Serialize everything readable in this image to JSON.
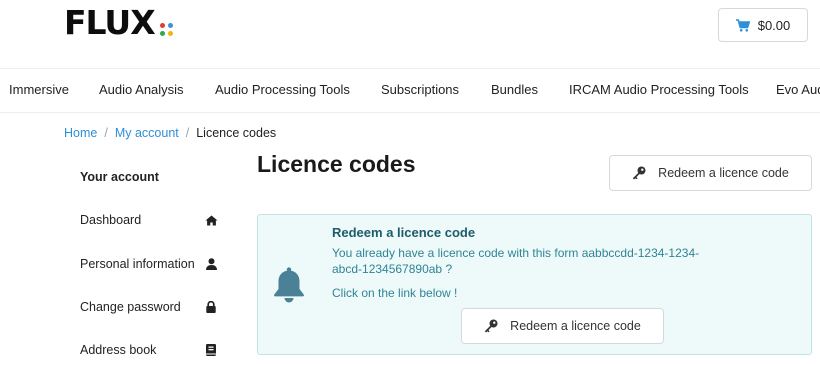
{
  "brand": {
    "name": "FLUX",
    "dot_colors": [
      "#e53935",
      "#3d8fd6",
      "#2ea84a",
      "#f2b705"
    ]
  },
  "cart": {
    "icon": "shopping-cart-icon",
    "total": "$0.00"
  },
  "nav": {
    "items": [
      "Immersive",
      "Audio Analysis",
      "Audio Processing Tools",
      "Subscriptions",
      "Bundles",
      "IRCAM Audio Processing Tools",
      "Evo Aud"
    ]
  },
  "breadcrumb": {
    "home": "Home",
    "account": "My account",
    "current": "Licence codes",
    "separator": "/"
  },
  "sidebar": {
    "title": "Your account",
    "items": [
      {
        "label": "Dashboard",
        "icon": "home-icon"
      },
      {
        "label": "Personal information",
        "icon": "user-icon"
      },
      {
        "label": "Change password",
        "icon": "lock-icon"
      },
      {
        "label": "Address book",
        "icon": "address-book-icon"
      }
    ]
  },
  "main": {
    "title": "Licence codes",
    "redeem_button": "Redeem a licence code",
    "alert": {
      "icon": "bell-icon",
      "title": "Redeem a licence code",
      "message": "You already have a licence code with this form aabbccdd-1234-1234-abcd-1234567890ab ?",
      "message2": "Click on the link below !",
      "button": "Redeem a licence code"
    }
  },
  "colors": {
    "link": "#2f8fd8",
    "alert_bg": "#eefaf9",
    "alert_text": "#2e8496",
    "alert_title": "#1e5b6b",
    "bell": "#4a8196"
  }
}
